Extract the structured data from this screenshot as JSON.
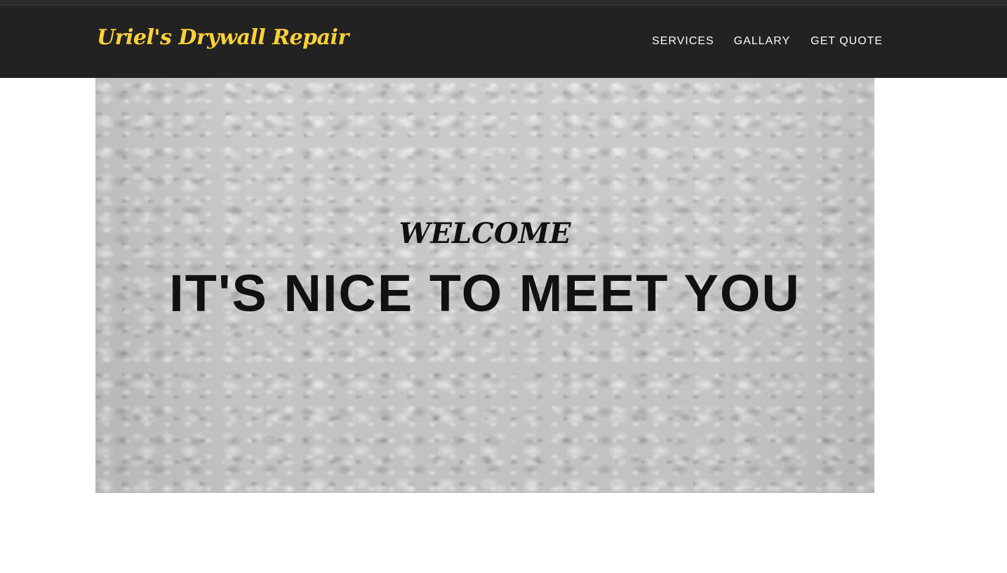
{
  "header": {
    "brand": "Uriel's Drywall Repair",
    "nav": [
      {
        "label": "SERVICES"
      },
      {
        "label": "GALLARY"
      },
      {
        "label": "GET QUOTE"
      }
    ]
  },
  "hero": {
    "subheading": "WELCOME",
    "heading": "IT'S NICE TO MEET YOU"
  },
  "colors": {
    "header_bg": "#222222",
    "brand": "#fed136",
    "nav_text": "#ffffff",
    "hero_text": "#111111"
  }
}
